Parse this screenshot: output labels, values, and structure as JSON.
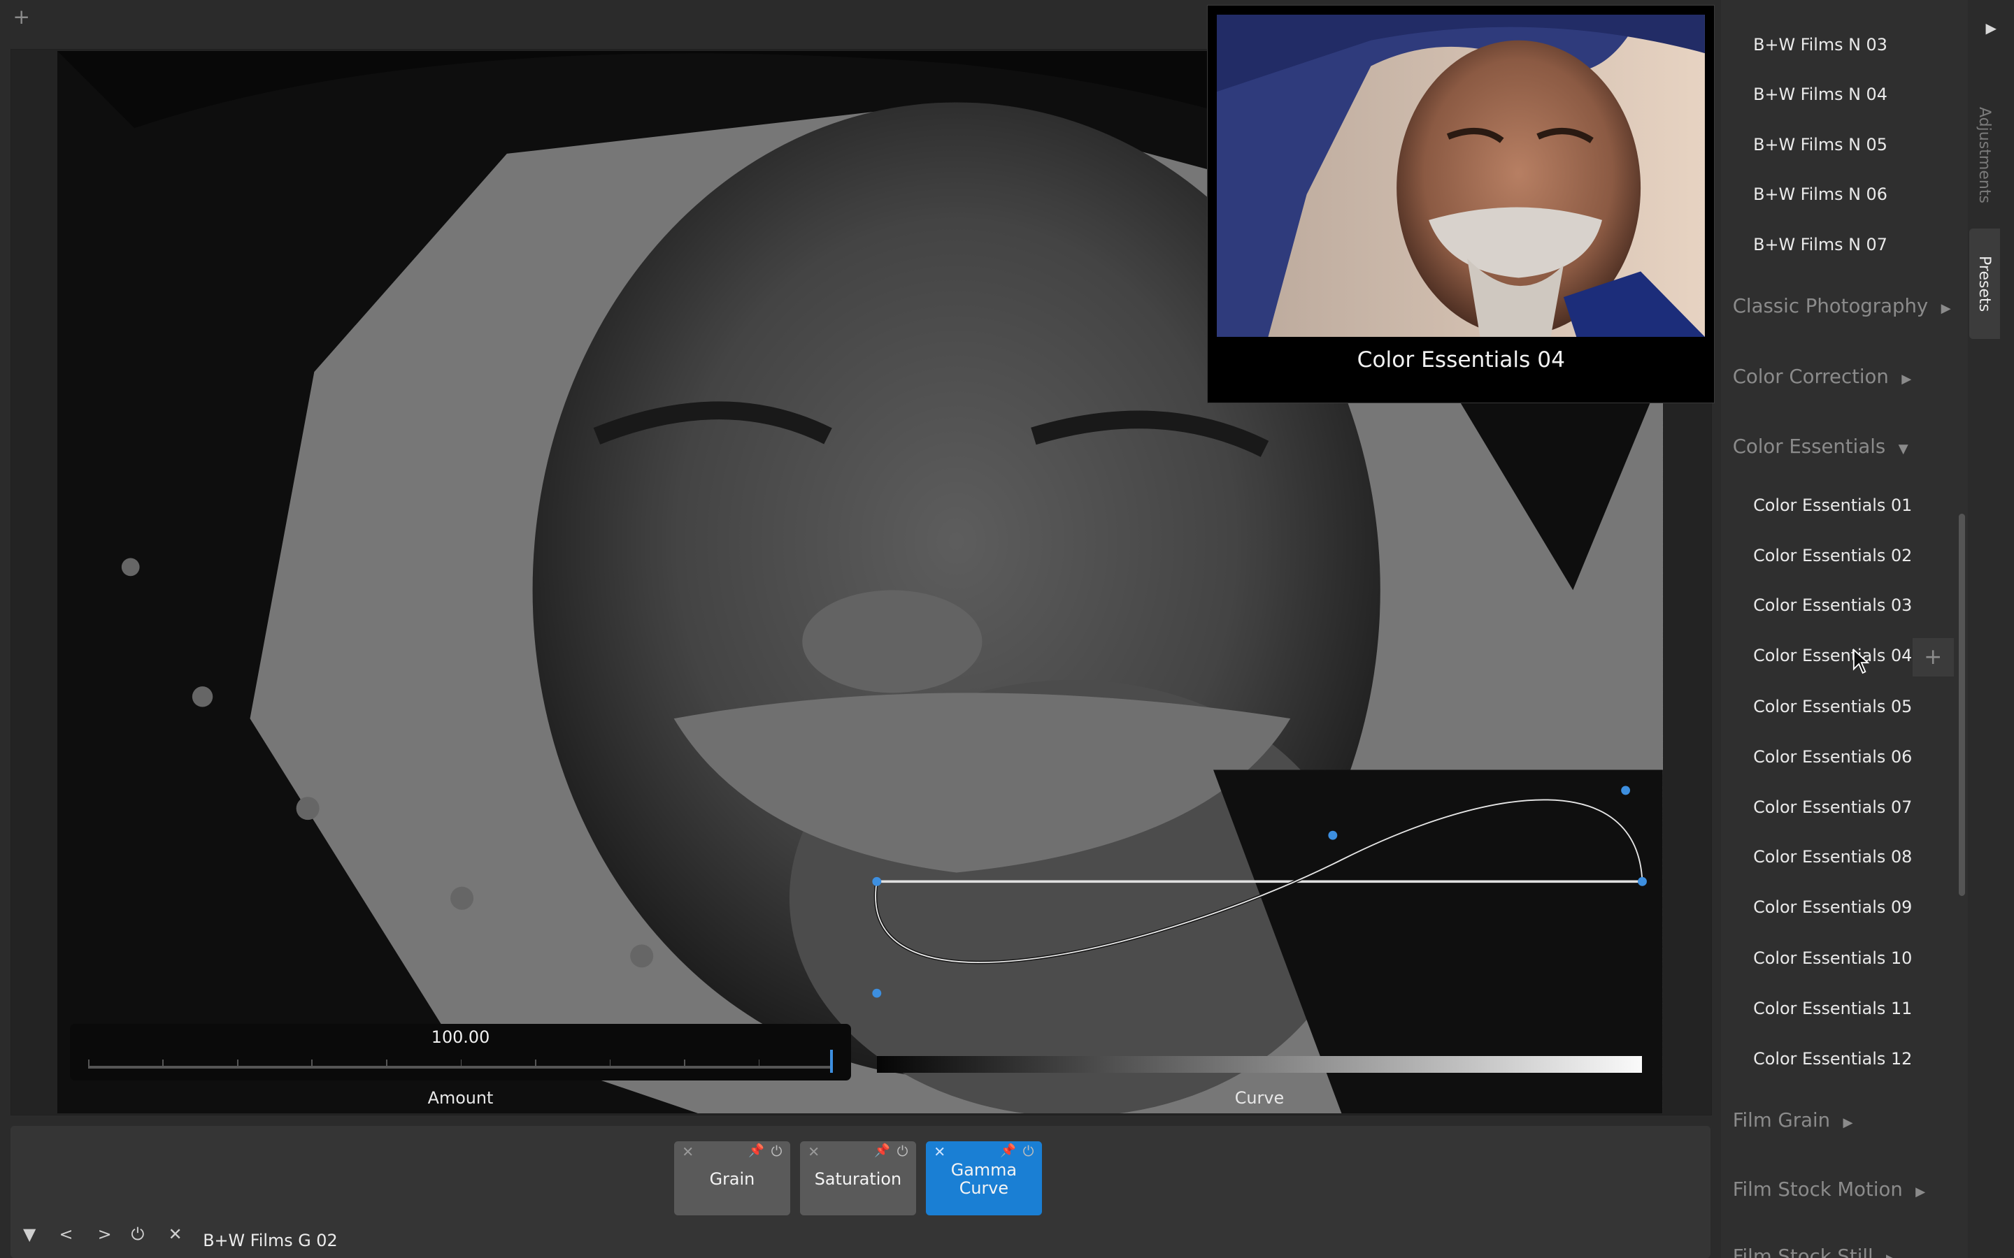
{
  "viewer": {
    "amount_value": "100.00",
    "amount_label": "Amount",
    "amount_fraction": 1.0,
    "curve_label": "Curve"
  },
  "preview": {
    "caption": "Color Essentials 04"
  },
  "nodes": [
    {
      "label": "Grain",
      "active": false
    },
    {
      "label": "Saturation",
      "active": false
    },
    {
      "label": "Gamma Curve",
      "active": true
    }
  ],
  "footer": {
    "current_preset": "B+W Films G 02"
  },
  "sidebar": {
    "items_top": [
      "B+W Films N 03",
      "B+W Films N 04",
      "B+W Films N 05",
      "B+W Films N 06",
      "B+W Films N 07"
    ],
    "categories_before": [
      "Classic Photography",
      "Color Correction"
    ],
    "open_category": "Color Essentials",
    "items": [
      "Color Essentials 01",
      "Color Essentials 02",
      "Color Essentials 03",
      "Color Essentials 04",
      "Color Essentials 05",
      "Color Essentials 06",
      "Color Essentials 07",
      "Color Essentials 08",
      "Color Essentials 09",
      "Color Essentials 10",
      "Color Essentials 11",
      "Color Essentials 12"
    ],
    "categories_after": [
      "Film Grain",
      "Film Stock Motion",
      "Film Stock Still"
    ],
    "hovered_item": "Color Essentials 04"
  },
  "tabs": {
    "adjustments": "Adjustments",
    "presets": "Presets"
  },
  "colors": {
    "accent": "#1a7fd4",
    "curve_point": "#3d8fe0"
  }
}
